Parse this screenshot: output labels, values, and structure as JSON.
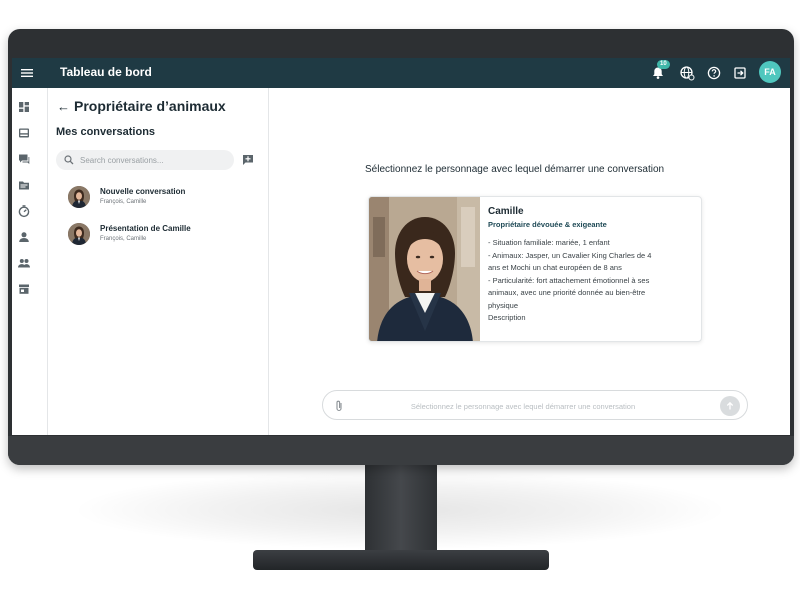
{
  "topbar": {
    "title": "Tableau de bord",
    "notification_count": "10",
    "user_initials": "FA"
  },
  "sidebar": {
    "items": [
      {
        "icon": "dashboard-icon"
      },
      {
        "icon": "inbox-icon"
      },
      {
        "icon": "chat-icon"
      },
      {
        "icon": "folder-icon"
      },
      {
        "icon": "timer-icon"
      },
      {
        "icon": "person-icon"
      },
      {
        "icon": "group-icon"
      },
      {
        "icon": "store-icon"
      }
    ]
  },
  "conversations": {
    "page_title": "Propriétaire d’animaux",
    "section_title": "Mes conversations",
    "search_placeholder": "Search conversations...",
    "items": [
      {
        "title": "Nouvelle conversation",
        "participants": "François, Camille"
      },
      {
        "title": "Présentation de Camille",
        "participants": "François, Camille"
      }
    ]
  },
  "main": {
    "prompt": "Sélectionnez le personnage avec lequel démarrer une conversation",
    "persona": {
      "name": "Camille",
      "role": "Propriétaire dévouée & exigeante",
      "lines": [
        "- Situation familiale: mariée, 1 enfant",
        "- Animaux: Jasper, un Cavalier King Charles de 4",
        "ans et Mochi un chat européen de 8 ans",
        "- Particularité: fort attachement émotionnel à ses",
        "animaux, avec une priorité donnée au bien-être",
        "physique",
        "Description"
      ]
    },
    "input_placeholder": "Sélectionnez le personnage avec lequel démarrer une conversation"
  },
  "colors": {
    "topbar": "#1f3a44",
    "accent": "#4fc7be",
    "badge": "#3fb6a8"
  }
}
